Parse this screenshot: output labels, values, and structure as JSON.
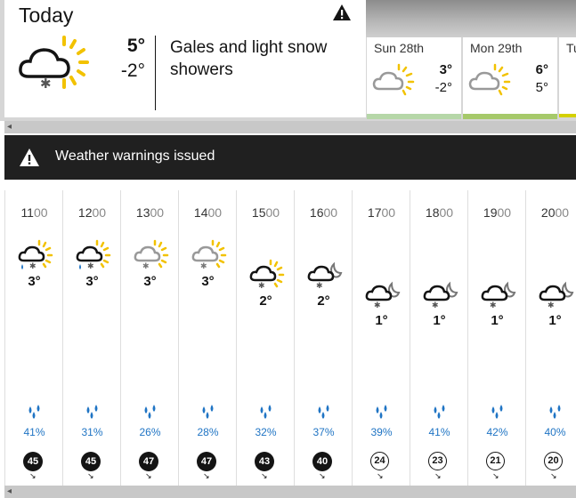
{
  "today": {
    "title": "Today",
    "high": "5°",
    "low": "-2°",
    "description": "Gales and light snow showers"
  },
  "days": [
    {
      "name": "Sun 28th",
      "high": "3°",
      "low": "-2°",
      "strip_color": "#b6d7a8"
    },
    {
      "name": "Mon 29th",
      "high": "6°",
      "low": "5°",
      "strip_color": "#a6c96a"
    },
    {
      "name": "Tu",
      "high": "",
      "low": "",
      "strip_color": "#d4d000"
    }
  ],
  "banner": {
    "text": "Weather warnings issued"
  },
  "hours": [
    {
      "hh": "11",
      "mm": "00",
      "temp": "3°",
      "icon": "sleet-sun",
      "pct": "41%",
      "wind": "45",
      "strong": true
    },
    {
      "hh": "12",
      "mm": "00",
      "temp": "3°",
      "icon": "sleet-sun",
      "pct": "31%",
      "wind": "45",
      "strong": true
    },
    {
      "hh": "13",
      "mm": "00",
      "temp": "3°",
      "icon": "grey-snow-sun",
      "pct": "26%",
      "wind": "47",
      "strong": true
    },
    {
      "hh": "14",
      "mm": "00",
      "temp": "3°",
      "icon": "grey-snow-sun",
      "pct": "28%",
      "wind": "47",
      "strong": true
    },
    {
      "hh": "15",
      "mm": "00",
      "temp": "2°",
      "icon": "snow-sun",
      "pct": "32%",
      "wind": "43",
      "strong": true
    },
    {
      "hh": "16",
      "mm": "00",
      "temp": "2°",
      "icon": "snow-moon",
      "pct": "37%",
      "wind": "40",
      "strong": true
    },
    {
      "hh": "17",
      "mm": "00",
      "temp": "1°",
      "icon": "snow-moon",
      "pct": "39%",
      "wind": "24",
      "strong": false
    },
    {
      "hh": "18",
      "mm": "00",
      "temp": "1°",
      "icon": "snow-moon",
      "pct": "41%",
      "wind": "23",
      "strong": false
    },
    {
      "hh": "19",
      "mm": "00",
      "temp": "1°",
      "icon": "snow-moon",
      "pct": "42%",
      "wind": "21",
      "strong": false
    },
    {
      "hh": "20",
      "mm": "00",
      "temp": "1°",
      "icon": "snow-moon",
      "pct": "40%",
      "wind": "20",
      "strong": false
    }
  ],
  "colors": {
    "sun": "#f2c200",
    "rain": "#1f74c4",
    "banner_bg": "#202020"
  }
}
